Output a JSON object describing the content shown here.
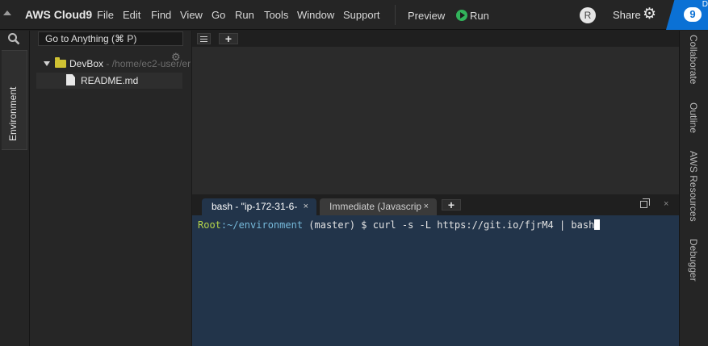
{
  "menubar": {
    "brand": "AWS Cloud9",
    "menus": [
      "File",
      "Edit",
      "Find",
      "View",
      "Go",
      "Run",
      "Tools",
      "Window",
      "Support"
    ],
    "preview": "Preview",
    "run": "Run",
    "avatar_initial": "R",
    "share": "Share",
    "help_badge": "9",
    "corner_letter": "D"
  },
  "left_rail": {
    "environment_tab": "Environment"
  },
  "file_tree": {
    "goto_placeholder": "Go to Anything (⌘ P)",
    "root_name": "DevBox",
    "root_path": " - /home/ec2-user/er",
    "files": [
      "README.md"
    ]
  },
  "console": {
    "tabs": [
      {
        "label": "bash - \"ip-172-31-6-",
        "close": "×"
      },
      {
        "label": "Immediate (Javascrip",
        "close": "×"
      }
    ],
    "close_console": "×",
    "prompt_user": "Root",
    "prompt_path": ":~/environment",
    "command": " (master) $ curl -s -L https://git.io/fjrM4 | bash"
  },
  "right_rail": [
    "Collaborate",
    "Outline",
    "AWS Resources",
    "Debugger"
  ],
  "colors": {
    "accent": "#0b71d5",
    "run_green": "#32b35b",
    "terminal_bg": "#22344a",
    "folder": "#d0c233"
  }
}
